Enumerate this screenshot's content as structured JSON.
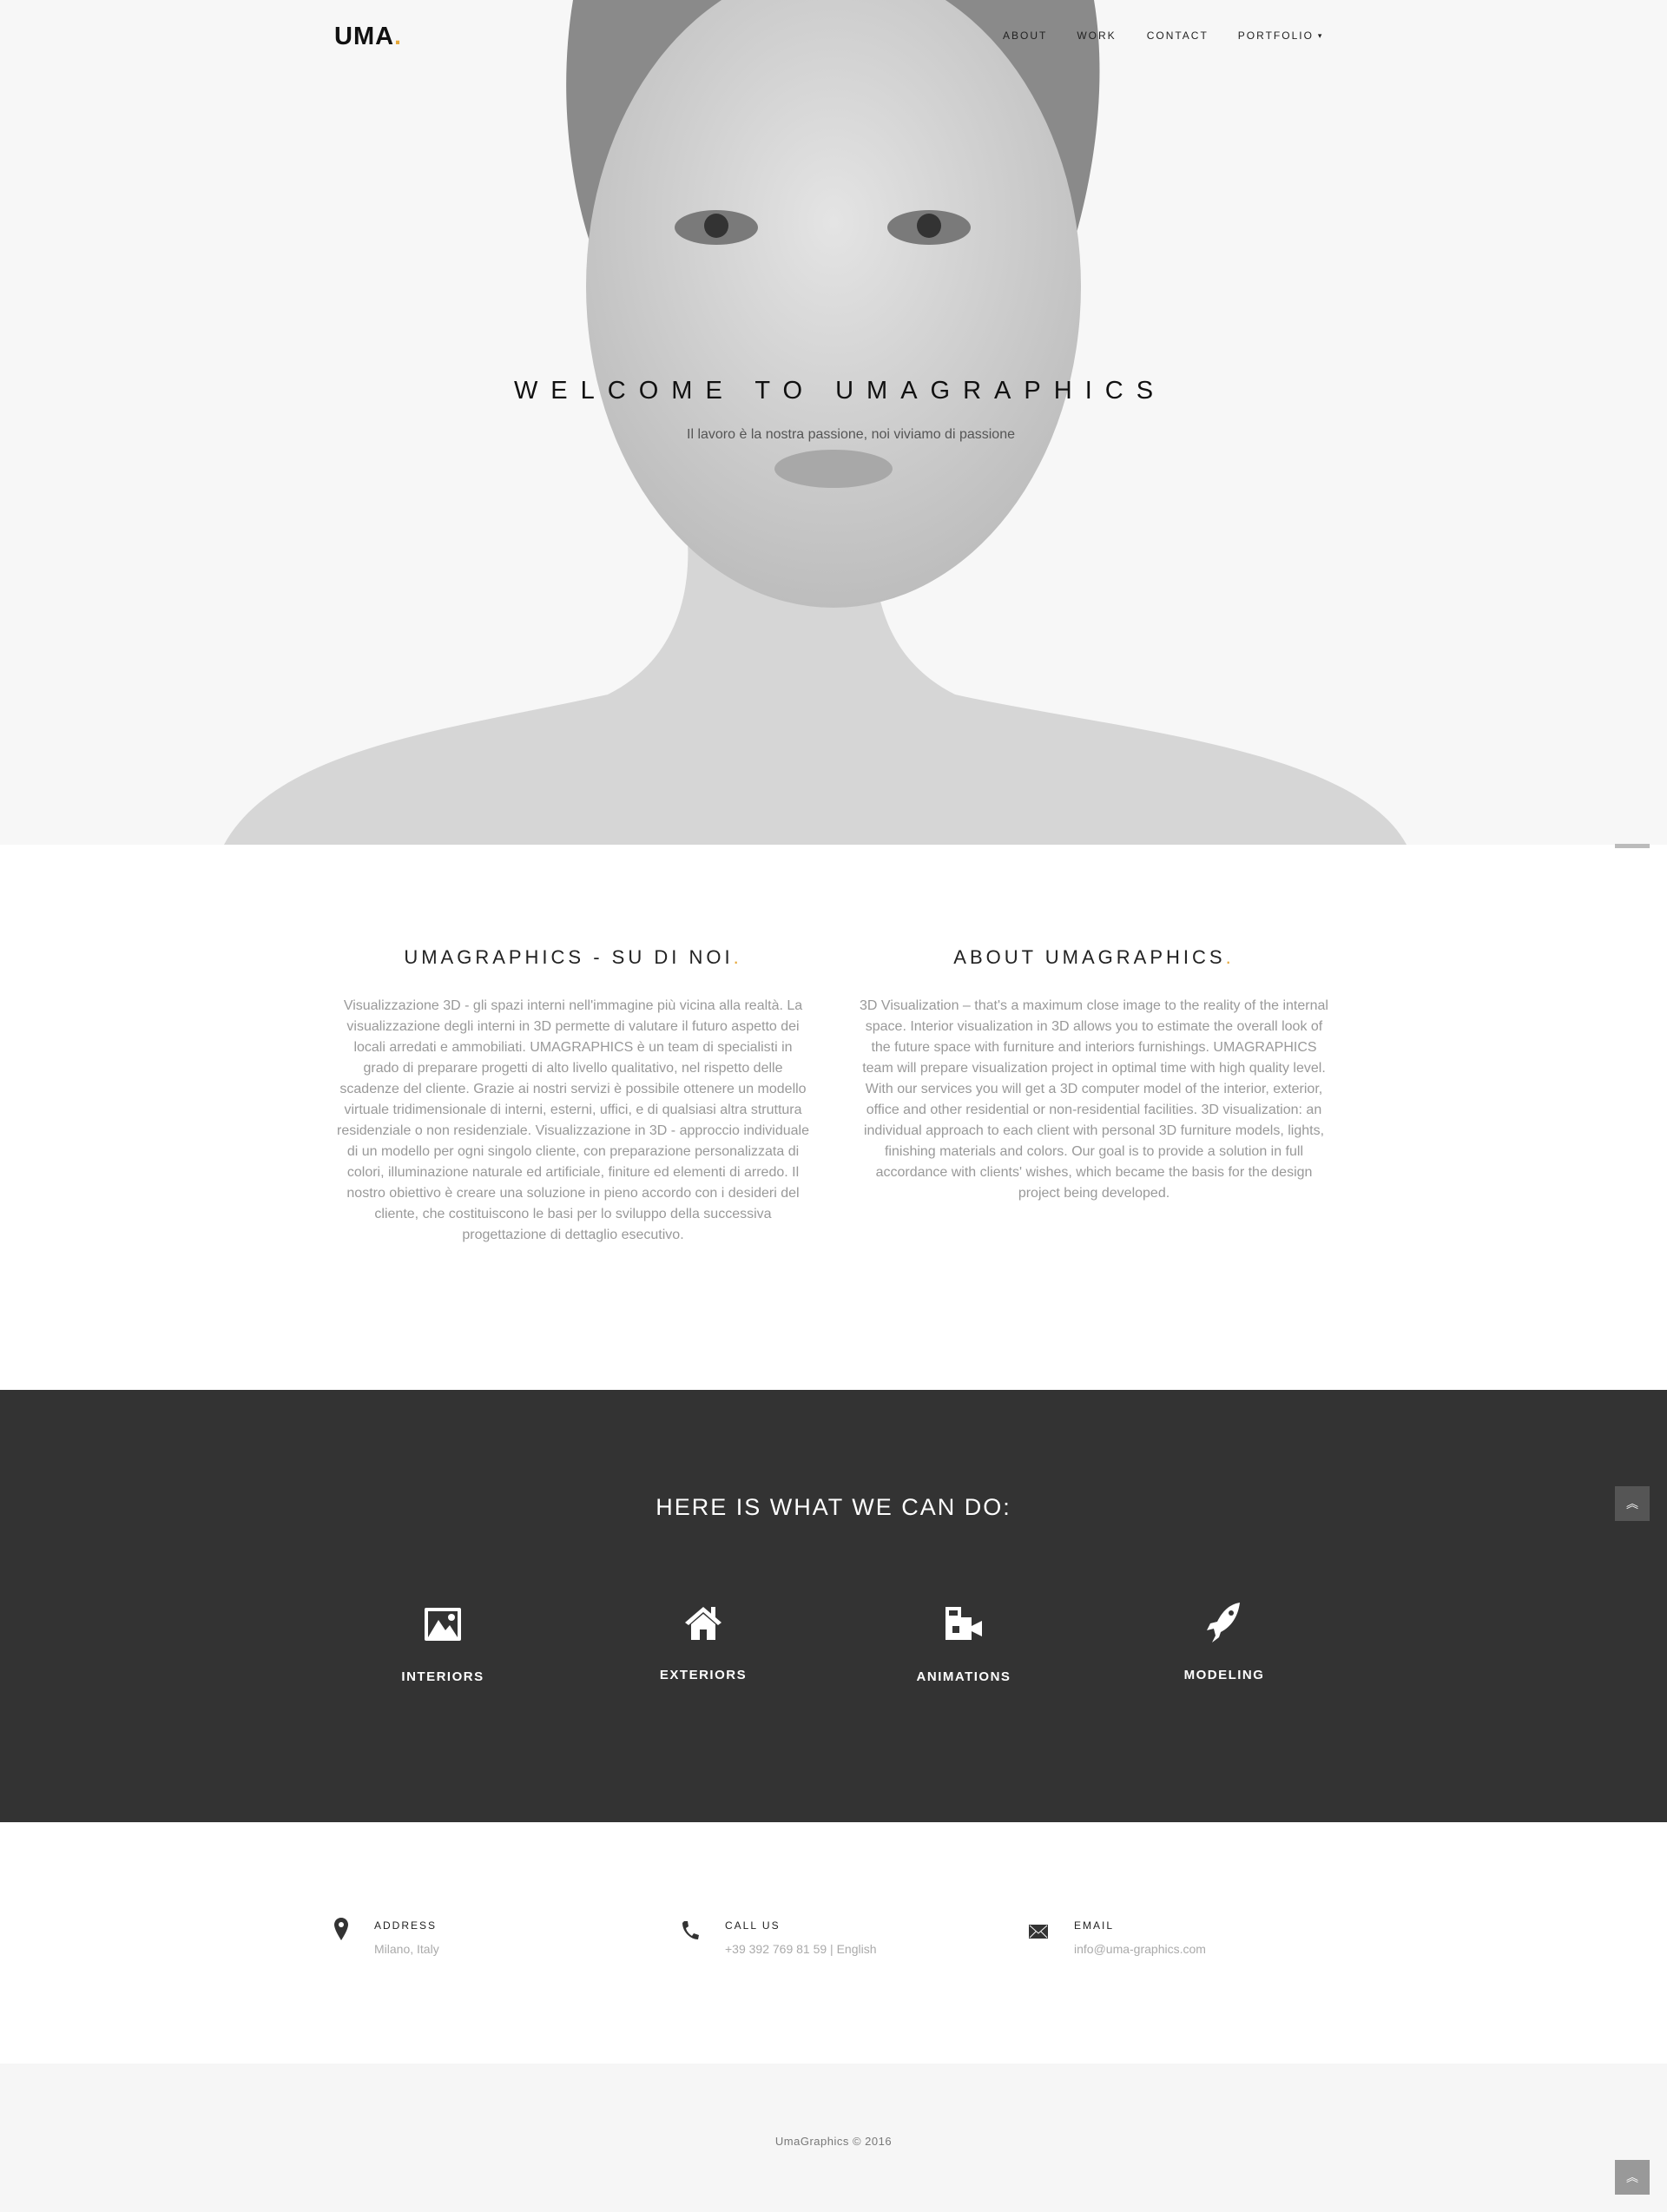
{
  "header": {
    "logo": "UMA",
    "logo_dot": ".",
    "nav": [
      {
        "label": "ABOUT"
      },
      {
        "label": "WORK"
      },
      {
        "label": "CONTACT"
      },
      {
        "label": "PORTFOLIO",
        "chevron": "▾"
      }
    ]
  },
  "hero": {
    "title": "WELCOME TO UMAGRAPHICS",
    "subtitle": "Il lavoro è la nostra passione, noi viviamo di passione"
  },
  "about": [
    {
      "title": "UMAGRAPHICS - SU DI NOI",
      "text": "Visualizzazione 3D - gli spazi interni nell'immagine più vicina alla realtà. La visualizzazione degli interni in 3D permette di valutare il futuro aspetto dei locali arredati e ammobiliati. UMAGRAPHICS è un team di specialisti in grado di preparare progetti di alto livello qualitativo, nel rispetto delle scadenze del cliente. Grazie ai nostri servizi è possibile ottenere un modello virtuale tridimensionale di interni, esterni, uffici, e di qualsiasi altra struttura residenziale o non residenziale. Visualizzazione in 3D - approccio individuale di un modello per ogni singolo cliente, con preparazione personalizzata di colori, illuminazione naturale ed artificiale, finiture ed elementi di arredo. Il nostro obiettivo è creare una soluzione in pieno accordo con i desideri del cliente, che costituiscono le basi per lo sviluppo della successiva progettazione di dettaglio esecutivo."
    },
    {
      "title": "ABOUT UMAGRAPHICS",
      "text": "3D Visualization – that's a maximum close image to the reality of the internal space. Interior visualization in 3D allows you to estimate the overall look of the future space with furniture and interiors furnishings. UMAGRAPHICS team will prepare visualization project in optimal time with high quality level. With our services you will get a 3D computer model of the interior, exterior, office and other residential or non-residential facilities. 3D visualization: an individual approach to each client with personal 3D furniture models, lights, finishing materials and colors. Our goal is to provide a solution in full accordance with clients' wishes, which became the basis for the design project being developed."
    }
  ],
  "services": {
    "title": "HERE IS WHAT WE CAN DO:",
    "items": [
      {
        "label": "INTERIORS",
        "icon": "picture-icon"
      },
      {
        "label": "EXTERIORS",
        "icon": "house-icon"
      },
      {
        "label": "ANIMATIONS",
        "icon": "video-camera-icon"
      },
      {
        "label": "MODELING",
        "icon": "rocket-icon"
      }
    ]
  },
  "contact": [
    {
      "label": "ADDRESS",
      "value": "Milano, Italy",
      "icon": "map-marker-icon"
    },
    {
      "label": "CALL US",
      "value": "+39 392 769 81 59 | English",
      "icon": "phone-icon"
    },
    {
      "label": "EMAIL",
      "value": "info@uma-graphics.com",
      "icon": "envelope-icon"
    }
  ],
  "footer": {
    "copyright": "UmaGraphics © 2016"
  },
  "colors": {
    "accent": "#e6a83a",
    "dark": "#333333",
    "footer_bg": "#f6f6f6"
  }
}
